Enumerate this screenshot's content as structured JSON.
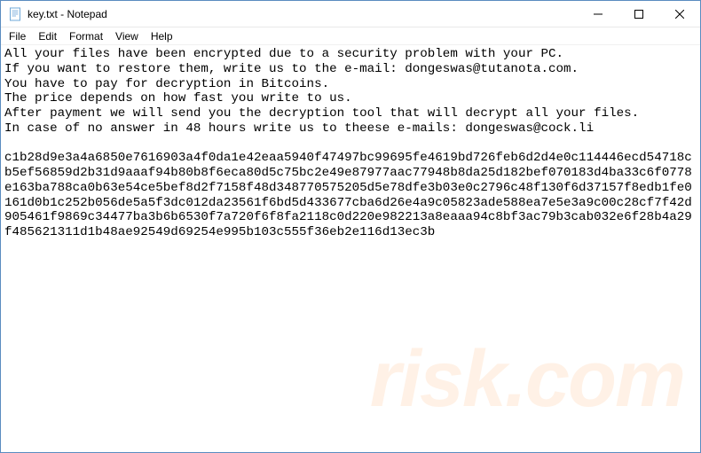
{
  "titlebar": {
    "title": "key.txt - Notepad"
  },
  "menubar": {
    "file": "File",
    "edit": "Edit",
    "format": "Format",
    "view": "View",
    "help": "Help"
  },
  "body_text": "All your files have been encrypted due to a security problem with your PC.\nIf you want to restore them, write us to the e-mail: dongeswas@tutanota.com.\nYou have to pay for decryption in Bitcoins.\nThe price depends on how fast you write to us.\nAfter payment we will send you the decryption tool that will decrypt all your files.\nIn case of no answer in 48 hours write us to theese e-mails: dongeswas@cock.li\n\nc1b28d9e3a4a6850e7616903a4f0da1e42eaa5940f47497bc99695fe4619bd726feb6d2d4e0c114446ecd54718cb5ef56859d2b31d9aaaf94b80b8f6eca80d5c75bc2e49e87977aac77948b8da25d182bef070183d4ba33c6f0778e163ba788ca0b63e54ce5bef8d2f7158f48d348770575205d5e78dfe3b03e0c2796c48f130f6d37157f8edb1fe0161d0b1c252b056de5a5f3dc012da23561f6bd5d433677cba6d26e4a9c05823ade588ea7e5e3a9c00c28cf7f42d905461f9869c34477ba3b6b6530f7a720f6f8fa2118c0d220e982213a8eaaa94c8bf3ac79b3cab032e6f28b4a29f485621311d1b48ae92549d69254e995b103c555f36eb2e116d13ec3b",
  "watermark": "risk.com"
}
